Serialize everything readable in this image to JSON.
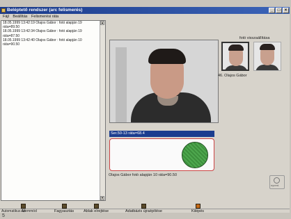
{
  "window": {
    "title": "Beléptető rendszer (arc felismerés)",
    "controls": [
      "_",
      "□",
      "×"
    ]
  },
  "menu": [
    "Fájl",
    "Beállítás",
    "Felismerési ráta"
  ],
  "log": {
    "lines": [
      "18.05.1999 13:42:19 Olajos Gábor : fotó alapján 19",
      "ráta=89.50",
      "18.05.1999 13:42:34 Olajos Gábor : fotó alapján 19",
      "ráta=87.50",
      "18.05.1999 13:42:40 Olajos Gábor : fotó alapján 10",
      "ráta=90.50"
    ]
  },
  "photo_panel": {
    "label": "fotó visszaállítása",
    "caption": "46. Olajos Gábor"
  },
  "result": {
    "header": "Ser.50-13 ráta=68.4",
    "caption": "Olajos Gábor   fotó alapján 10  ráta=90.50",
    "accent": "#1b3d8f",
    "match_color": "#3d8f3d"
  },
  "side_icon_label": "nyomt.",
  "toolbar": [
    {
      "label": "Áll",
      "icon": "stop-icon"
    },
    {
      "label": "Fagyasztás",
      "icon": "freeze-icon"
    },
    {
      "label": "Ablak elrejtése",
      "icon": "hide-window-icon"
    },
    {
      "label": "Adatbázis újraépítése",
      "icon": "database-icon"
    },
    {
      "label": "Kilépés",
      "icon": "exit-icon"
    }
  ],
  "status": "Automatikus üzemmód",
  "corner_number": "5"
}
